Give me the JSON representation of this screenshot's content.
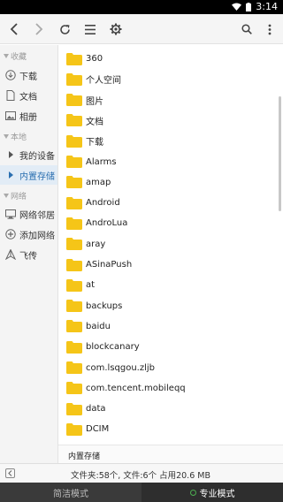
{
  "statusbar": {
    "time": "3:14"
  },
  "toolbar": {
    "icons": [
      "chevron-left-icon",
      "chevron-right-icon",
      "refresh-icon",
      "list-view-icon",
      "gear-icon",
      "search-icon",
      "more-vert-icon"
    ]
  },
  "sidebar": {
    "favorites_header": "收藏",
    "favorites": [
      {
        "label": "下载",
        "icon": "download-icon"
      },
      {
        "label": "文档",
        "icon": "document-icon"
      },
      {
        "label": "相册",
        "icon": "image-icon"
      }
    ],
    "local_header": "本地",
    "local": [
      {
        "label": "我的设备",
        "icon": "triangle-right-icon"
      },
      {
        "label": "内置存储",
        "icon": "triangle-right-icon"
      }
    ],
    "network_header": "网络",
    "network": [
      {
        "label": "网络邻居",
        "icon": "monitor-icon"
      },
      {
        "label": "添加网络",
        "icon": "add-circle-icon"
      },
      {
        "label": "飞传",
        "icon": "send-icon"
      }
    ]
  },
  "files": [
    "360",
    "个人空间",
    "图片",
    "文档",
    "下载",
    "Alarms",
    "amap",
    "Android",
    "AndroLua",
    "aray",
    "ASinaPush",
    "at",
    "backups",
    "baidu",
    "blockcanary",
    "com.lsqgou.zljb",
    "com.tencent.mobileqq",
    "data",
    "DCIM"
  ],
  "pathbar": {
    "path": "内置存储"
  },
  "infobar": {
    "text": "文件夹:58个, 文件:6个 占用20.6 MB"
  },
  "bottombar": {
    "simple_mode": "简洁模式",
    "pro_mode": "专业模式"
  },
  "colors": {
    "folder": "#f5c518",
    "accent": "#2a6fb0",
    "bottom": "#3a3a3a"
  }
}
